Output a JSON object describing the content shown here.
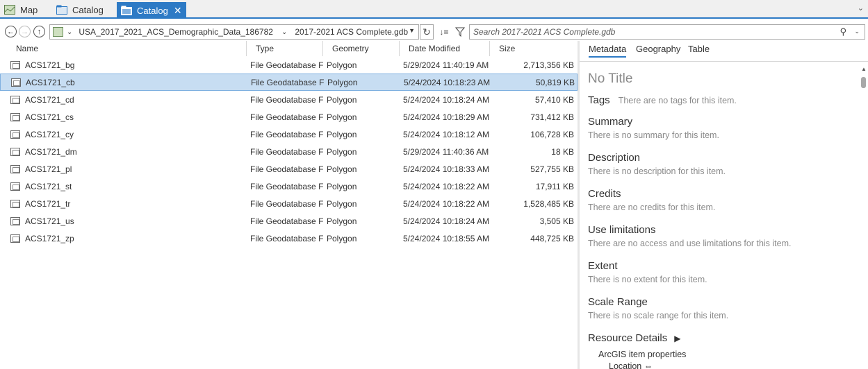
{
  "tabs": [
    {
      "label": "Map",
      "icon": "map-icon",
      "active": false
    },
    {
      "label": "Catalog",
      "icon": "catalog-icon",
      "active": false
    },
    {
      "label": "Catalog",
      "icon": "catalog-icon",
      "active": true
    }
  ],
  "address": {
    "segment1": "USA_2017_2021_ACS_Demographic_Data_186782",
    "segment2": "2017-2021 ACS Complete.gdb"
  },
  "search": {
    "placeholder": "Search 2017-2021 ACS Complete.gdb"
  },
  "columns": [
    "Name",
    "Type",
    "Geometry",
    "Date Modified",
    "Size"
  ],
  "rows": [
    {
      "name": "ACS1721_bg",
      "type": "File Geodatabase F",
      "geometry": "Polygon",
      "date": "5/29/2024 11:40:19 AM",
      "size": "2,713,356 KB",
      "selected": false
    },
    {
      "name": "ACS1721_cb",
      "type": "File Geodatabase F",
      "geometry": "Polygon",
      "date": "5/24/2024 10:18:23 AM",
      "size": "50,819 KB",
      "selected": true
    },
    {
      "name": "ACS1721_cd",
      "type": "File Geodatabase F",
      "geometry": "Polygon",
      "date": "5/24/2024 10:18:24 AM",
      "size": "57,410 KB",
      "selected": false
    },
    {
      "name": "ACS1721_cs",
      "type": "File Geodatabase F",
      "geometry": "Polygon",
      "date": "5/24/2024 10:18:29 AM",
      "size": "731,412 KB",
      "selected": false
    },
    {
      "name": "ACS1721_cy",
      "type": "File Geodatabase F",
      "geometry": "Polygon",
      "date": "5/24/2024 10:18:12 AM",
      "size": "106,728 KB",
      "selected": false
    },
    {
      "name": "ACS1721_dm",
      "type": "File Geodatabase F",
      "geometry": "Polygon",
      "date": "5/29/2024 11:40:36 AM",
      "size": "18 KB",
      "selected": false
    },
    {
      "name": "ACS1721_pl",
      "type": "File Geodatabase F",
      "geometry": "Polygon",
      "date": "5/24/2024 10:18:33 AM",
      "size": "527,755 KB",
      "selected": false
    },
    {
      "name": "ACS1721_st",
      "type": "File Geodatabase F",
      "geometry": "Polygon",
      "date": "5/24/2024 10:18:22 AM",
      "size": "17,911 KB",
      "selected": false
    },
    {
      "name": "ACS1721_tr",
      "type": "File Geodatabase F",
      "geometry": "Polygon",
      "date": "5/24/2024 10:18:22 AM",
      "size": "1,528,485 KB",
      "selected": false
    },
    {
      "name": "ACS1721_us",
      "type": "File Geodatabase F",
      "geometry": "Polygon",
      "date": "5/24/2024 10:18:24 AM",
      "size": "3,505 KB",
      "selected": false
    },
    {
      "name": "ACS1721_zp",
      "type": "File Geodatabase F",
      "geometry": "Polygon",
      "date": "5/24/2024 10:18:55 AM",
      "size": "448,725 KB",
      "selected": false
    }
  ],
  "metadata": {
    "tabs": [
      "Metadata",
      "Geography",
      "Table"
    ],
    "title": "No Title",
    "tags_label": "Tags",
    "tags_value": "There are no tags for this item.",
    "sections": [
      {
        "heading": "Summary",
        "text": "There is no summary for this item."
      },
      {
        "heading": "Description",
        "text": "There is no description for this item."
      },
      {
        "heading": "Credits",
        "text": "There are no credits for this item."
      },
      {
        "heading": "Use limitations",
        "text": "There are no access and use limitations for this item."
      },
      {
        "heading": "Extent",
        "text": "There is no extent for this item."
      },
      {
        "heading": "Scale Range",
        "text": "There is no scale range for this item."
      }
    ],
    "resource_details": "Resource Details",
    "arcgis_props": "ArcGIS item properties",
    "location": "Location"
  },
  "colors": {
    "accent": "#2d7ac5",
    "selection": "#c7ddf2"
  }
}
